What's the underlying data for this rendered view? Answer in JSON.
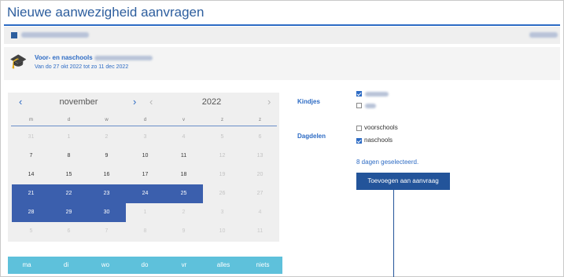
{
  "page": {
    "title": "Nieuwe aanwezigheid aanvragen"
  },
  "course": {
    "title": "Voor- en naschools",
    "dates": "Van do 27 okt 2022 tot zo 11 dec 2022"
  },
  "calendar": {
    "month": "november",
    "year": "2022",
    "weekdays": [
      "m",
      "d",
      "w",
      "d",
      "v",
      "z",
      "z"
    ],
    "weeks": [
      [
        {
          "d": "31",
          "s": "out"
        },
        {
          "d": "1",
          "s": "faint"
        },
        {
          "d": "2",
          "s": "faint"
        },
        {
          "d": "3",
          "s": "faint"
        },
        {
          "d": "4",
          "s": "faint"
        },
        {
          "d": "5",
          "s": "faint"
        },
        {
          "d": "6",
          "s": "faint"
        }
      ],
      [
        {
          "d": "7",
          "s": "norm"
        },
        {
          "d": "8",
          "s": "norm"
        },
        {
          "d": "9",
          "s": "norm"
        },
        {
          "d": "10",
          "s": "norm"
        },
        {
          "d": "11",
          "s": "norm"
        },
        {
          "d": "12",
          "s": "faint"
        },
        {
          "d": "13",
          "s": "faint"
        }
      ],
      [
        {
          "d": "14",
          "s": "norm"
        },
        {
          "d": "15",
          "s": "norm"
        },
        {
          "d": "16",
          "s": "norm"
        },
        {
          "d": "17",
          "s": "norm"
        },
        {
          "d": "18",
          "s": "norm"
        },
        {
          "d": "19",
          "s": "faint"
        },
        {
          "d": "20",
          "s": "faint"
        }
      ],
      [
        {
          "d": "21",
          "s": "sel"
        },
        {
          "d": "22",
          "s": "sel"
        },
        {
          "d": "23",
          "s": "sel"
        },
        {
          "d": "24",
          "s": "sel"
        },
        {
          "d": "25",
          "s": "sel"
        },
        {
          "d": "26",
          "s": "faint"
        },
        {
          "d": "27",
          "s": "faint"
        }
      ],
      [
        {
          "d": "28",
          "s": "sel"
        },
        {
          "d": "29",
          "s": "sel"
        },
        {
          "d": "30",
          "s": "sel"
        },
        {
          "d": "1",
          "s": "out"
        },
        {
          "d": "2",
          "s": "out"
        },
        {
          "d": "3",
          "s": "out"
        },
        {
          "d": "4",
          "s": "out"
        }
      ],
      [
        {
          "d": "5",
          "s": "out"
        },
        {
          "d": "6",
          "s": "out"
        },
        {
          "d": "7",
          "s": "out"
        },
        {
          "d": "8",
          "s": "out"
        },
        {
          "d": "9",
          "s": "out"
        },
        {
          "d": "10",
          "s": "out"
        },
        {
          "d": "11",
          "s": "out"
        }
      ]
    ]
  },
  "quick_select": [
    "ma",
    "di",
    "wo",
    "do",
    "vr",
    "alles",
    "niets"
  ],
  "form": {
    "kindjes_label": "Kindjes",
    "kids": [
      {
        "checked": true
      },
      {
        "checked": false
      }
    ],
    "dagdelen_label": "Dagdelen",
    "dagdelen": [
      {
        "label": "voorschools",
        "checked": false
      },
      {
        "label": "naschools",
        "checked": true
      }
    ],
    "selected_info": "8 dagen geselecteerd.",
    "add_button": "Toevoegen aan aanvraag"
  },
  "icons": {
    "building": "building-icon",
    "graduation": "graduation-cap-icon",
    "prev": "chevron-left-icon",
    "next": "chevron-right-icon"
  },
  "colors": {
    "primary": "#2d6bc4",
    "selected_day": "#3b5fad",
    "quick_bar": "#5ec1db",
    "button": "#23549a"
  }
}
